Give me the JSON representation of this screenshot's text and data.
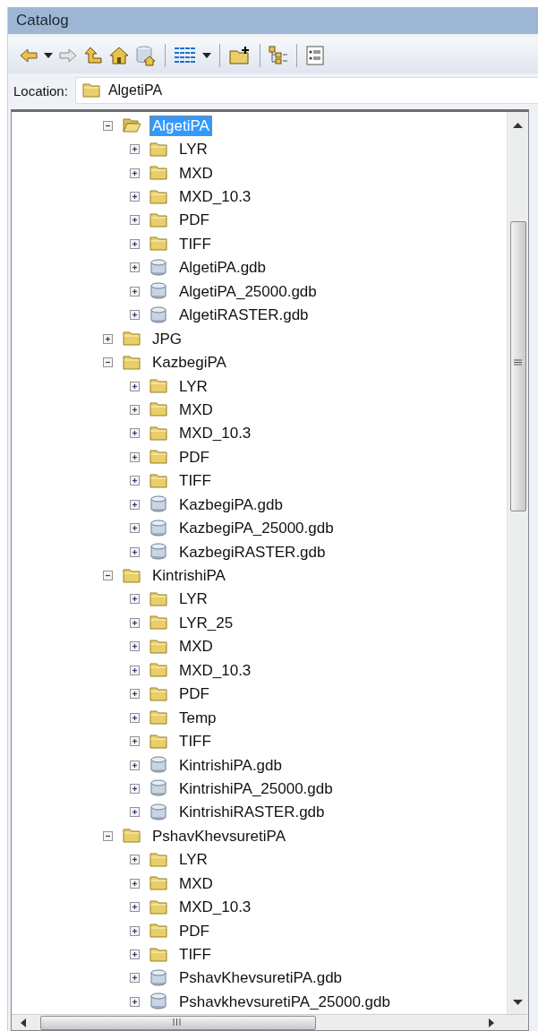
{
  "window": {
    "title": "Catalog"
  },
  "location": {
    "label": "Location:",
    "value": "AlgetiPA"
  },
  "tree": {
    "items": [
      {
        "label": "AlgetiPA",
        "kind": "folder",
        "expanded": true,
        "selected": true,
        "children": [
          {
            "label": "LYR",
            "kind": "folder",
            "expanded": false,
            "selected": false
          },
          {
            "label": "MXD",
            "kind": "folder",
            "expanded": false,
            "selected": false
          },
          {
            "label": "MXD_10.3",
            "kind": "folder",
            "expanded": false,
            "selected": false
          },
          {
            "label": "PDF",
            "kind": "folder",
            "expanded": false,
            "selected": false
          },
          {
            "label": "TIFF",
            "kind": "folder",
            "expanded": false,
            "selected": false
          },
          {
            "label": "AlgetiPA.gdb",
            "kind": "gdb",
            "expanded": false,
            "selected": false
          },
          {
            "label": "AlgetiPA_25000.gdb",
            "kind": "gdb",
            "expanded": false,
            "selected": false
          },
          {
            "label": "AlgetiRASTER.gdb",
            "kind": "gdb",
            "expanded": false,
            "selected": false
          }
        ]
      },
      {
        "label": "JPG",
        "kind": "folder",
        "expanded": false,
        "selected": false
      },
      {
        "label": "KazbegiPA",
        "kind": "folder",
        "expanded": true,
        "selected": false,
        "children": [
          {
            "label": "LYR",
            "kind": "folder",
            "expanded": false,
            "selected": false
          },
          {
            "label": "MXD",
            "kind": "folder",
            "expanded": false,
            "selected": false
          },
          {
            "label": "MXD_10.3",
            "kind": "folder",
            "expanded": false,
            "selected": false
          },
          {
            "label": "PDF",
            "kind": "folder",
            "expanded": false,
            "selected": false
          },
          {
            "label": "TIFF",
            "kind": "folder",
            "expanded": false,
            "selected": false
          },
          {
            "label": "KazbegiPA.gdb",
            "kind": "gdb",
            "expanded": false,
            "selected": false
          },
          {
            "label": "KazbegiPA_25000.gdb",
            "kind": "gdb",
            "expanded": false,
            "selected": false
          },
          {
            "label": "KazbegiRASTER.gdb",
            "kind": "gdb",
            "expanded": false,
            "selected": false
          }
        ]
      },
      {
        "label": "KintrishiPA",
        "kind": "folder",
        "expanded": true,
        "selected": false,
        "children": [
          {
            "label": "LYR",
            "kind": "folder",
            "expanded": false,
            "selected": false
          },
          {
            "label": "LYR_25",
            "kind": "folder",
            "expanded": false,
            "selected": false
          },
          {
            "label": "MXD",
            "kind": "folder",
            "expanded": false,
            "selected": false
          },
          {
            "label": "MXD_10.3",
            "kind": "folder",
            "expanded": false,
            "selected": false
          },
          {
            "label": "PDF",
            "kind": "folder",
            "expanded": false,
            "selected": false
          },
          {
            "label": "Temp",
            "kind": "folder",
            "expanded": false,
            "selected": false
          },
          {
            "label": "TIFF",
            "kind": "folder",
            "expanded": false,
            "selected": false
          },
          {
            "label": "KintrishiPA.gdb",
            "kind": "gdb",
            "expanded": false,
            "selected": false
          },
          {
            "label": "KintrishiPA_25000.gdb",
            "kind": "gdb",
            "expanded": false,
            "selected": false
          },
          {
            "label": "KintrishiRASTER.gdb",
            "kind": "gdb",
            "expanded": false,
            "selected": false
          }
        ]
      },
      {
        "label": "PshavKhevsuretiPA",
        "kind": "folder",
        "expanded": true,
        "selected": false,
        "children": [
          {
            "label": "LYR",
            "kind": "folder",
            "expanded": false,
            "selected": false
          },
          {
            "label": "MXD",
            "kind": "folder",
            "expanded": false,
            "selected": false
          },
          {
            "label": "MXD_10.3",
            "kind": "folder",
            "expanded": false,
            "selected": false
          },
          {
            "label": "PDF",
            "kind": "folder",
            "expanded": false,
            "selected": false
          },
          {
            "label": "TIFF",
            "kind": "folder",
            "expanded": false,
            "selected": false
          },
          {
            "label": "PshavKhevsuretiPA.gdb",
            "kind": "gdb",
            "expanded": false,
            "selected": false
          },
          {
            "label": "PshavkhevsuretiPA_25000.gdb",
            "kind": "gdb",
            "expanded": false,
            "selected": false
          }
        ]
      }
    ]
  }
}
